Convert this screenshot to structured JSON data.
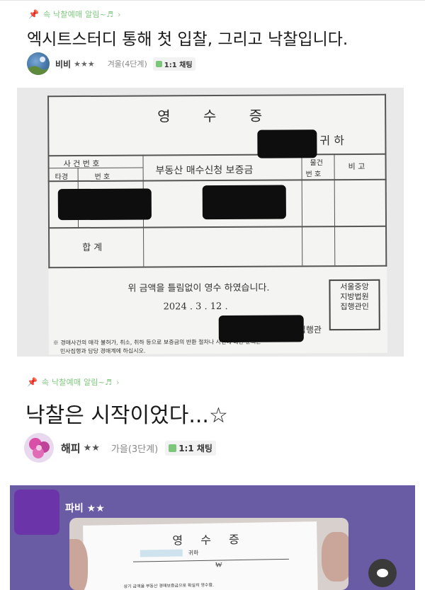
{
  "post1": {
    "breadcrumb": "속 낙찰예매 알림~♬",
    "title": "엑시트스터디 통해 첫 입찰, 그리고 낙찰입니다.",
    "author": {
      "name": "비비",
      "stars": "★★★",
      "grade": "겨울(4단계)",
      "chat_label": "1:1 채팅"
    },
    "receipt": {
      "title": "영 수 증",
      "honorific": "귀 하",
      "col_case_number": "사 건 번 호",
      "col_sub1": "타경",
      "col_sub2": "번 호",
      "col_deposit": "부동산 매수신청 보증금",
      "col_item": "물건",
      "col_item2": "번 호",
      "col_note": "비 고",
      "total_label": "합 계",
      "statement": "위 금액을 틀림없이 영수 하였습니다.",
      "date": "2024 .  3  .  12  .",
      "officer_label": "집행관",
      "seal_text": "서울중앙\n지방법원\n집행관인",
      "footnote_line1": "※ 경매사건의 매각 불허가, 취소, 취하 등으로 보증금의 반환 절차나 사건에 대한 문의는",
      "footnote_line2": "민사집행과 담당 경매계에 하십시오."
    }
  },
  "post2": {
    "breadcrumb": "속 낙찰예매 알림~♬",
    "title": "낙찰은 시작이었다...☆",
    "author": {
      "name": "해피",
      "stars": "★★",
      "grade": "가을(3단계)",
      "chat_label": "1:1 채팅"
    }
  },
  "comment_card": {
    "name": "파비",
    "stars": "★★",
    "receipt_title": "영 수 증",
    "honorific": "귀하",
    "amount_prefix": "₩",
    "statement": "상기 금액을 부동산 경매보증금으로 확실히 영수함."
  },
  "colors": {
    "breadcrumb_green": "#7fc77f",
    "pin_red": "#e0383e",
    "card_purple": "#6a5ba5",
    "avatar_purple": "#6b34a8",
    "chat_icon_green": "#7bc67b"
  }
}
